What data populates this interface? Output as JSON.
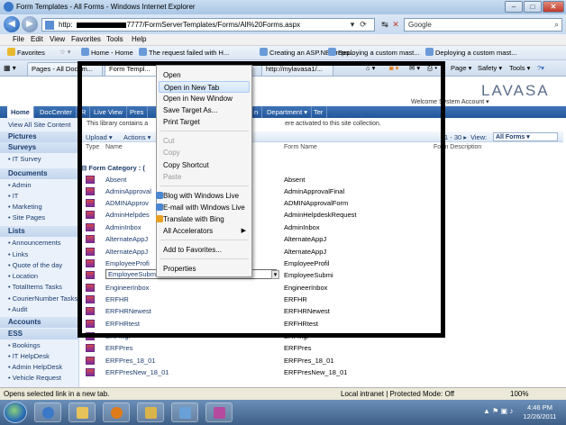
{
  "window": {
    "title": "Form Templates - All Forms - Windows Internet Explorer",
    "min": "–",
    "max": "□",
    "close": "✕"
  },
  "address": {
    "url_prefix": "http:",
    "url_suffix": "7777/FormServerTemplates/Forms/All%20Forms.aspx"
  },
  "search": {
    "placeholder": "Google",
    "icon": "search-icon"
  },
  "menubar": [
    "File",
    "Edit",
    "View",
    "Favorites",
    "Tools",
    "Help"
  ],
  "favorites": {
    "label": "Favorites",
    "items": [
      "Home - Home",
      "The request failed with H...",
      "Creating an ASP.NET repo...",
      "Deploying a custom mast...",
      "Deploying a custom mast..."
    ]
  },
  "tabs": [
    "Pages - All Docum...",
    "Form Templ...",
    "http://mylavasa1/..."
  ],
  "commandbar": {
    "page": "Page ▾",
    "safety": "Safety ▾",
    "tools": "Tools ▾",
    "help": "?▾"
  },
  "sharepoint": {
    "brand": "LAVASA",
    "welcome": "Welcome System Account ▾"
  },
  "topnav": [
    "Home",
    "DocCenter",
    "R",
    "Live View",
    "Pres",
    "n",
    "Department ▾",
    "Ter"
  ],
  "leftnav": {
    "view_all": "View All Site Content",
    "sections": [
      {
        "title": "Pictures",
        "items": []
      },
      {
        "title": "Surveys",
        "items": [
          "IT Survey"
        ]
      },
      {
        "title": "Documents",
        "items": [
          "Admin",
          "IT",
          "Marketing",
          "Site Pages"
        ]
      },
      {
        "title": "Lists",
        "items": [
          "Announcements",
          "Links",
          "Quote of the day",
          "Location",
          "TotalItems Tasks",
          "CourierNumber Tasks",
          "Audit"
        ]
      },
      {
        "title": "Accounts",
        "items": []
      },
      {
        "title": "ESS",
        "items": [
          "Bookings",
          "IT HelpDesk",
          "Admin HelpDesk",
          "Vehicle Request"
        ]
      }
    ]
  },
  "library": {
    "note_left": "This library contains a",
    "note_right": "ere activated to this site collection.",
    "toolbar": {
      "upload": "Upload ▾",
      "actions": "Actions ▾",
      "paging": "1 - 30 ▸",
      "view_label": "View:",
      "view_value": "All Forms ▾"
    },
    "columns": {
      "type": "Type",
      "name": "Name",
      "form_name": "Form Name",
      "form_description": "Form Description"
    },
    "group": "⊟ Form Category : (",
    "rows": [
      {
        "name": "Absent",
        "form_name": "Absent"
      },
      {
        "name": "AdminApproval",
        "form_name": "AdminApprovalFinal"
      },
      {
        "name": "ADMINApprov",
        "form_name": "ADMINApprovalForm"
      },
      {
        "name": "AdminHelpdes",
        "form_name": "AdminHelpdeskRequest"
      },
      {
        "name": "AdminInbox",
        "form_name": "AdminInbox"
      },
      {
        "name": "AlternateAppJ",
        "form_name": "AlternateAppJ"
      },
      {
        "name": "AlternateAppJ",
        "form_name": "AlternateAppJ"
      },
      {
        "name": "EmployeeProfi",
        "form_name": "EmployeeProfil"
      },
      {
        "name": "EmployeeSubmi",
        "form_name": "EmployeeSubmi",
        "selected": true
      },
      {
        "name": "EngineerInbox",
        "form_name": "EngineerInbox"
      },
      {
        "name": "ERFHR",
        "form_name": "ERFHR"
      },
      {
        "name": "ERFHRNewest",
        "form_name": "ERFHRNewest"
      },
      {
        "name": "ERFHRtest",
        "form_name": "ERFHRtest"
      },
      {
        "name": "ERFMgr",
        "form_name": "ERFMgr"
      },
      {
        "name": "ERFPres",
        "form_name": "ERFPres"
      },
      {
        "name": "ERFPres_18_01",
        "form_name": "ERFPres_18_01"
      },
      {
        "name": "ERFPresNew_18_01",
        "form_name": "ERFPresNew_18_01"
      }
    ]
  },
  "context_menu": {
    "items": [
      {
        "label": "Open"
      },
      {
        "label": "Open in New Tab",
        "hover": true
      },
      {
        "label": "Open in New Window"
      },
      {
        "label": "Save Target As..."
      },
      {
        "label": "Print Target"
      },
      {
        "sep": true
      },
      {
        "label": "Cut",
        "disabled": true
      },
      {
        "label": "Copy",
        "disabled": true
      },
      {
        "label": "Copy Shortcut"
      },
      {
        "label": "Paste",
        "disabled": true
      },
      {
        "sep": true
      },
      {
        "label": "Blog with Windows Live",
        "icon": true
      },
      {
        "label": "E-mail with Windows Live",
        "icon": true
      },
      {
        "label": "Translate with Bing",
        "icon": true
      },
      {
        "label": "All Accelerators",
        "submenu": true
      },
      {
        "sep": true
      },
      {
        "label": "Add to Favorites..."
      },
      {
        "sep": true
      },
      {
        "label": "Properties"
      }
    ]
  },
  "statusbar": {
    "text": "Opens selected link in a new tab.",
    "zone": "Local intranet | Protected Mode: Off",
    "zoom": "100%"
  },
  "taskbar": {
    "time": "4:46 PM",
    "date": "12/26/2011"
  }
}
